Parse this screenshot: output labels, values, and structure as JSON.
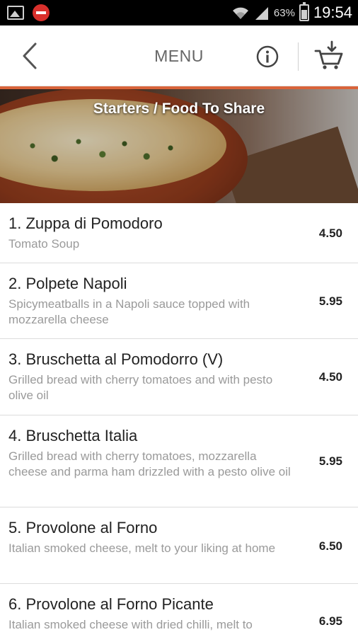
{
  "status_bar": {
    "battery_percent": "63%",
    "time": "19:54",
    "left_icons": [
      "image-icon",
      "blocked-icon"
    ],
    "right_icons": [
      "wifi-icon",
      "signal-icon",
      "battery-icon"
    ],
    "battery_level": 0.63
  },
  "app_bar": {
    "title": "MENU",
    "back_icon": "chevron-left-icon",
    "info_icon": "info-icon",
    "cart_icon": "cart-icon"
  },
  "banner": {
    "title": "Starters / Food To Share",
    "accent_color": "#d9643a"
  },
  "menu": {
    "items": [
      {
        "name": "1. Zuppa di Pomodoro",
        "description": "Tomato Soup",
        "price": "4.50"
      },
      {
        "name": "2. Polpete Napoli",
        "description": "Spicymeatballs in a Napoli sauce topped with mozzarella cheese",
        "price": "5.95"
      },
      {
        "name": "3. Bruschetta al Pomodorro (V)",
        "description": "Grilled bread with cherry tomatoes and with pesto olive oil",
        "price": "4.50"
      },
      {
        "name": "4. Bruschetta Italia",
        "description": "Grilled bread with cherry tomatoes, mozzarella cheese and parma ham drizzled with a pesto olive oil",
        "price": "5.95"
      },
      {
        "name": "5. Provolone al Forno",
        "description": "Italian smoked cheese, melt to your liking at home",
        "price": "6.50"
      },
      {
        "name": "6. Provolone al Forno Picante",
        "description": "Italian smoked cheese with dried chilli, melt to",
        "price": "6.95"
      }
    ]
  }
}
